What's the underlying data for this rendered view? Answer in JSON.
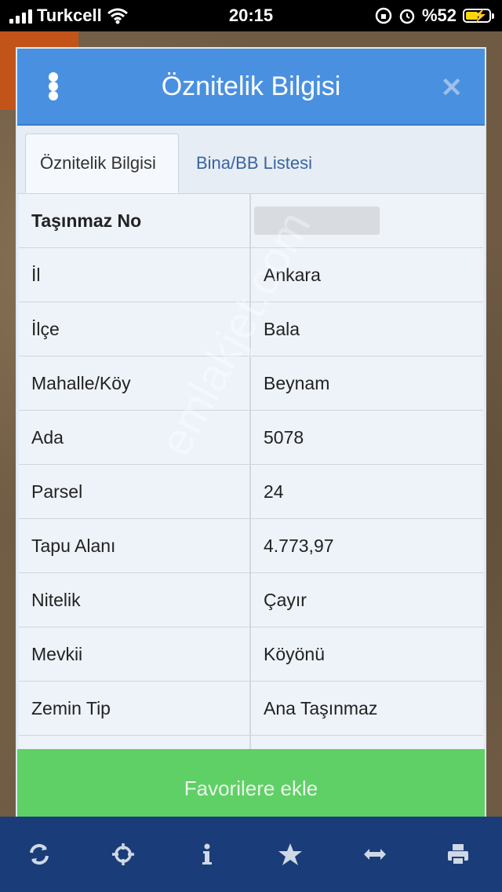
{
  "status_bar": {
    "carrier": "Turkcell",
    "time": "20:15",
    "battery": "%52",
    "battery_level": 0.52
  },
  "dialog": {
    "title": "Öznitelik Bilgisi",
    "tabs": [
      {
        "label": "Öznitelik Bilgisi",
        "active": true
      },
      {
        "label": "Bina/BB Listesi",
        "active": false
      }
    ],
    "rows": [
      {
        "key": "Taşınmaz No",
        "value": ""
      },
      {
        "key": "İl",
        "value": "Ankara"
      },
      {
        "key": "İlçe",
        "value": "Bala"
      },
      {
        "key": "Mahalle/Köy",
        "value": "Beynam"
      },
      {
        "key": "Ada",
        "value": "5078"
      },
      {
        "key": "Parsel",
        "value": "24"
      },
      {
        "key": "Tapu Alanı",
        "value": "4.773,97"
      },
      {
        "key": "Nitelik",
        "value": "Çayır"
      },
      {
        "key": "Mevkii",
        "value": "Köyönü"
      },
      {
        "key": "Zemin Tip",
        "value": "Ana Taşınmaz"
      }
    ],
    "favorite_button": "Favorilere ekle"
  },
  "watermark": "emlakjet.com",
  "toolbar_icons": [
    "refresh-icon",
    "crosshair-icon",
    "info-icon",
    "star-icon",
    "measure-icon",
    "print-icon"
  ],
  "colors": {
    "header_blue": "#4a90e0",
    "button_green": "#5fd065",
    "toolbar_navy": "#1a3c78"
  }
}
